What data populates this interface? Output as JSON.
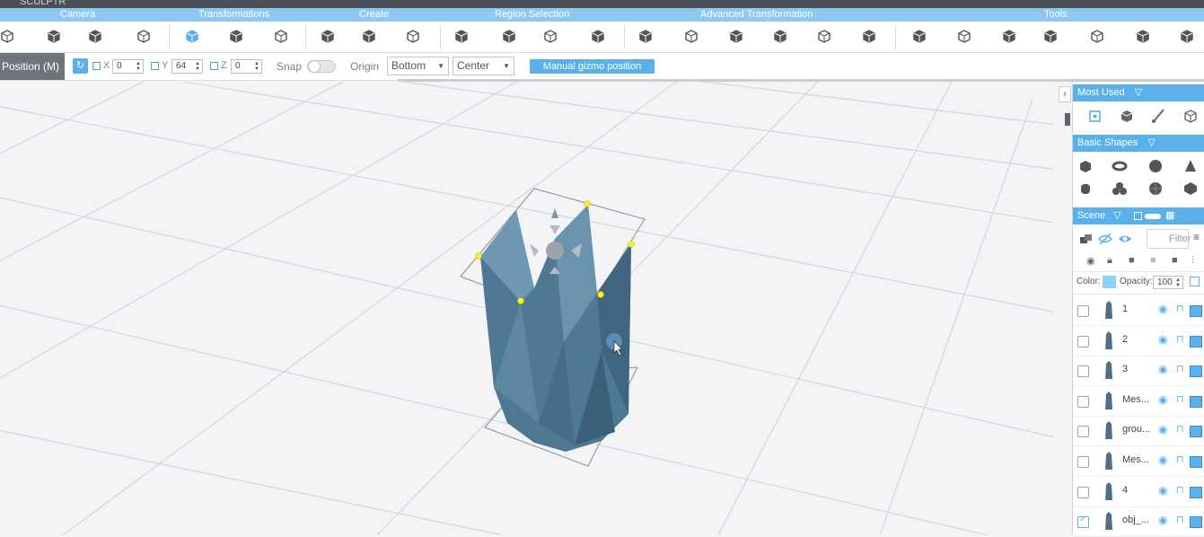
{
  "window": {
    "title": "SCULPTR"
  },
  "categories": [
    "Camera",
    "Transformations",
    "Create",
    "Region Selection",
    "Advanced Transformation",
    "Tools"
  ],
  "toolbar_icons": [
    "camera-reset-icon",
    "camera-rotate-icon",
    "camera-screenshot-icon",
    "camera-fit-icon",
    "move-tool-icon",
    "rotate-tool-icon",
    "scale-tool-icon",
    "create-box-icon",
    "create-extrude-icon",
    "create-solid-icon",
    "select-region-icon",
    "select-grow-icon",
    "select-transform-icon",
    "select-faces-icon",
    "bend-icon",
    "twist-icon",
    "taper-icon",
    "cone-icon",
    "warp-icon",
    "slice-icon",
    "tool-mesh-icon",
    "tool-solid-icon",
    "tool-wire-icon",
    "tool-sphere-icon",
    "tool-merge-icon",
    "tool-split-icon",
    "tool-knife-icon"
  ],
  "options": {
    "mode_label": "Position (M)",
    "x_label": "X",
    "x_value": "0",
    "y_label": "Y",
    "y_value": "64",
    "z_label": "Z",
    "z_value": "0",
    "snap_label": "Snap",
    "origin_label": "Origin",
    "origin_value": "Bottom",
    "pivot_value": "Center",
    "manual_label": "Manual gizmo position"
  },
  "panel": {
    "most_used": "Most Used",
    "basic_shapes": "Basic Shapes",
    "scene": "Scene",
    "filter_placeholder": "Filter",
    "color_label": "Color:",
    "opacity_label": "Opacity:",
    "opacity_value": "100",
    "accent": "#5ab0ea"
  },
  "scene_items": [
    {
      "name": "1",
      "checked": false
    },
    {
      "name": "2",
      "checked": false
    },
    {
      "name": "3",
      "checked": false
    },
    {
      "name": "Mes...",
      "checked": false
    },
    {
      "name": "grou...",
      "checked": false
    },
    {
      "name": "Mes...",
      "checked": false
    },
    {
      "name": "4",
      "checked": false
    },
    {
      "name": "obj_...",
      "checked": true
    }
  ]
}
